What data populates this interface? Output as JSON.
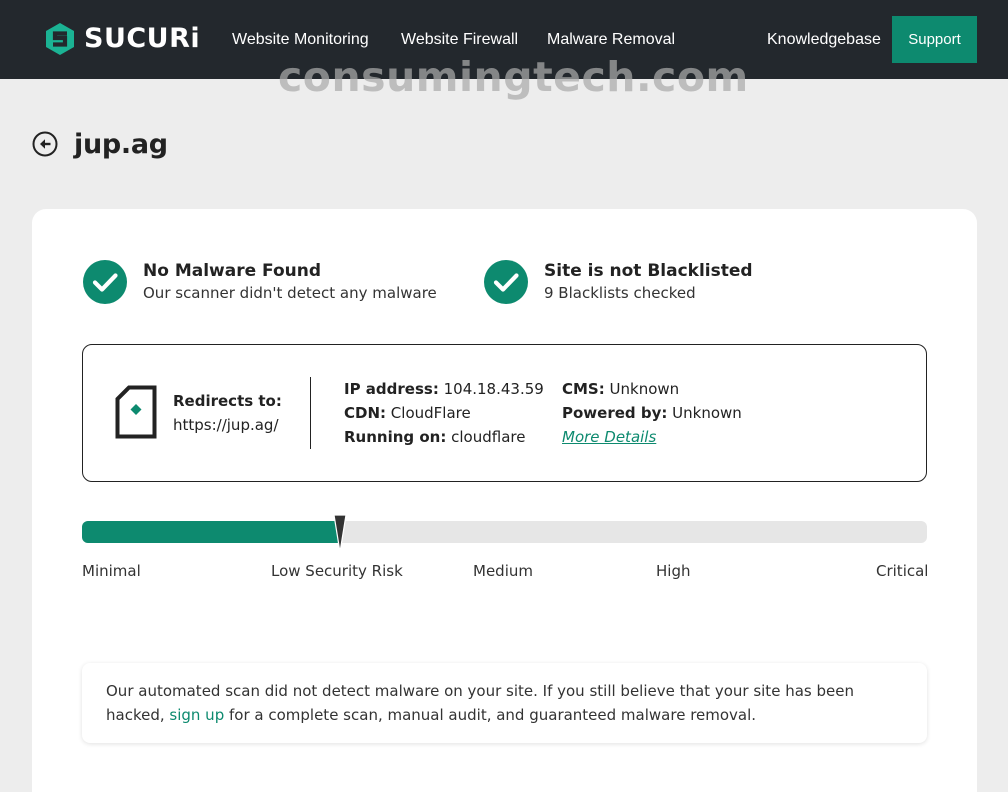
{
  "brand": {
    "logo_text": "SUCURi",
    "accent_color": "#0d8a6f",
    "nav_bg": "#23282d"
  },
  "nav": {
    "items": [
      {
        "label": "Website Monitoring"
      },
      {
        "label": "Website Firewall"
      },
      {
        "label": "Malware Removal"
      },
      {
        "label": "Knowledgebase"
      }
    ],
    "support_label": "Support"
  },
  "watermark": "consumingtech.com",
  "header": {
    "back_icon": "back-arrow-icon",
    "domain": "jup.ag"
  },
  "status": [
    {
      "icon": "check-icon",
      "title": "No Malware Found",
      "subtitle": "Our scanner didn't detect any malware"
    },
    {
      "icon": "check-icon",
      "title": "Site is not Blacklisted",
      "subtitle": "9 Blacklists checked"
    }
  ],
  "site_info": {
    "icon": "document-icon",
    "redirect_label": "Redirects to:",
    "redirect_url": "https://jup.ag/",
    "ip_label": "IP address:",
    "ip_value": "104.18.43.59",
    "cdn_label": "CDN:",
    "cdn_value": "CloudFlare",
    "running_label": "Running on:",
    "running_value": "cloudflare",
    "cms_label": "CMS:",
    "cms_value": "Unknown",
    "powered_label": "Powered by:",
    "powered_value": "Unknown",
    "more_details": "More Details"
  },
  "risk": {
    "level": 0.305,
    "current": "Low Security Risk",
    "labels": [
      "Minimal",
      "Low Security Risk",
      "Medium",
      "High",
      "Critical"
    ]
  },
  "notice": {
    "text_before": "Our automated scan did not detect malware on your site. If you still believe that your site has been hacked,",
    "link_text": "sign up",
    "text_after": "for a complete scan, manual audit, and guaranteed malware removal."
  }
}
